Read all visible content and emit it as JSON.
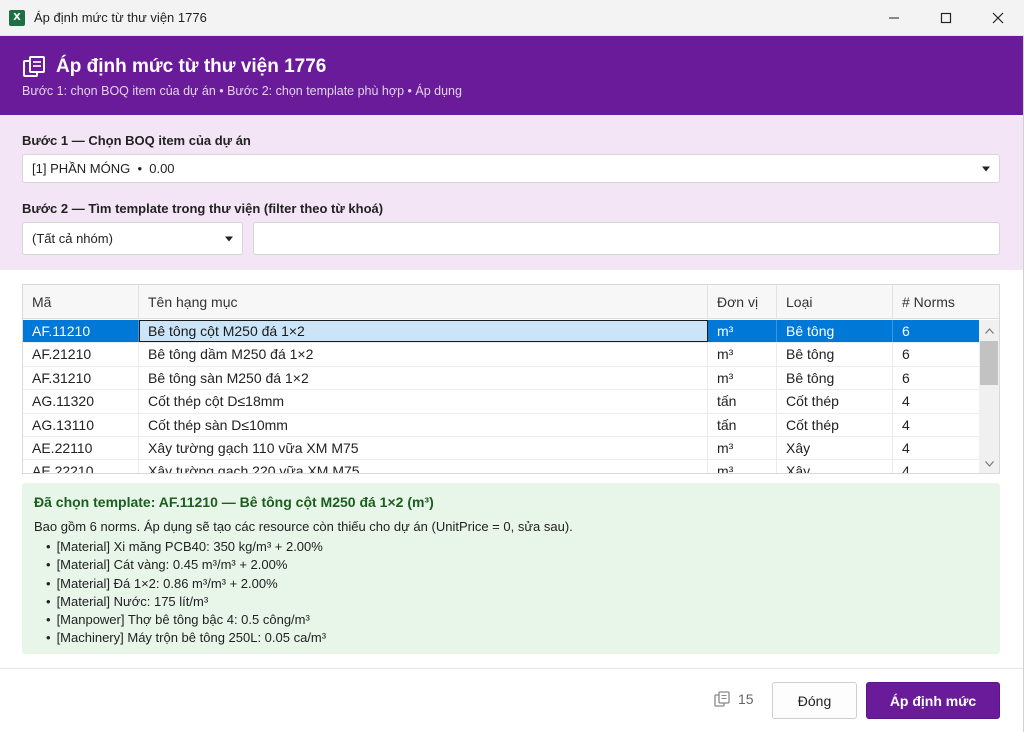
{
  "window": {
    "title": "Áp định mức từ thư viện 1776",
    "app_icon_letter": "X",
    "controls": [
      "minimize-icon",
      "maximize-icon",
      "close-icon"
    ]
  },
  "header": {
    "icon": "library-books-icon",
    "title": "Áp định mức từ thư viện 1776",
    "subtitle": "Bước 1: chọn BOQ item của dự án • Bước 2: chọn template phù hợp • Áp dụng"
  },
  "step1": {
    "label": "Bước 1 — Chọn BOQ item của dự án",
    "selected": "[1] PHẦN MÓNG  •  0.00"
  },
  "step2": {
    "label": "Bước 2 — Tìm template trong thư viện (filter theo từ khoá)",
    "group_selected": "(Tất cả nhóm)",
    "keyword_value": ""
  },
  "grid": {
    "columns": [
      "Mã",
      "Tên hạng mục",
      "Đơn vị",
      "Loại",
      "# Norms"
    ],
    "rows": [
      [
        "AF.11210",
        "Bê tông cột M250 đá 1×2",
        "m³",
        "Bê tông",
        "6"
      ],
      [
        "AF.21210",
        "Bê tông dầm M250 đá 1×2",
        "m³",
        "Bê tông",
        "6"
      ],
      [
        "AF.31210",
        "Bê tông sàn M250 đá 1×2",
        "m³",
        "Bê tông",
        "6"
      ],
      [
        "AG.11320",
        "Cốt thép cột D≤18mm",
        "tấn",
        "Cốt thép",
        "4"
      ],
      [
        "AG.13110",
        "Cốt thép sàn D≤10mm",
        "tấn",
        "Cốt thép",
        "4"
      ],
      [
        "AE.22110",
        "Xây tường gạch 110 vữa XM M75",
        "m³",
        "Xây",
        "4"
      ],
      [
        "AE.22210",
        "Xây tường gạch 220 vữa XM M75",
        "m³",
        "Xây",
        "4"
      ]
    ],
    "selected_index": 0
  },
  "detail": {
    "title": "Đã chọn template: AF.11210 — Bê tông cột M250 đá 1×2 (m³)",
    "description": "Bao gồm 6 norms. Áp dụng sẽ tạo các resource còn thiếu cho dự án (UnitPrice = 0, sửa sau).",
    "norms": [
      "[Material] Xi măng PCB40: 350 kg/m³ + 2.00%",
      "[Material] Cát vàng: 0.45 m³/m³ + 2.00%",
      "[Material] Đá 1×2: 0.86 m³/m³ + 2.00%",
      "[Material] Nước: 175 lít/m³",
      "[Manpower] Thợ bê tông bậc 4: 0.5 công/m³",
      "[Machinery] Máy trộn bê tông 250L: 0.05 ca/m³"
    ]
  },
  "footer": {
    "count_icon": "library-books-icon",
    "count": "15",
    "close_label": "Đóng",
    "apply_label": "Áp định mức"
  },
  "colors": {
    "brand_purple": "#6a1b9a",
    "step_panel_bg": "#f3e5f5",
    "selection_blue": "#0078d7",
    "detail_bg": "#e8f5e9",
    "detail_title": "#1b5e20"
  }
}
